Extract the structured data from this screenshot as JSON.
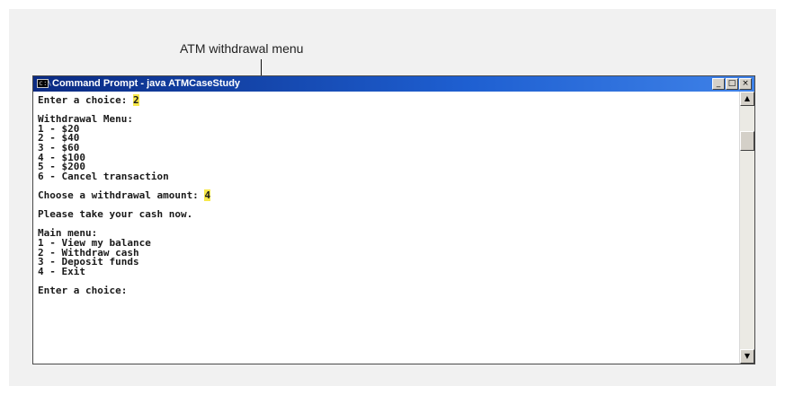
{
  "callout": {
    "label": "ATM withdrawal menu"
  },
  "window": {
    "title": "Command Prompt - java ATMCaseStudy",
    "controls": {
      "minimize": "_",
      "maximize": "□",
      "close": "×"
    }
  },
  "console": {
    "enter_choice_1": {
      "prompt": "Enter a choice: ",
      "input": "2"
    },
    "withdrawal_menu_title": "Withdrawal Menu:",
    "withdrawal_options": [
      "1 - $20",
      "2 - $40",
      "3 - $60",
      "4 - $100",
      "5 - $200",
      "6 - Cancel transaction"
    ],
    "choose_amount": {
      "prompt": "Choose a withdrawal amount: ",
      "input": "4"
    },
    "take_cash": "Please take your cash now.",
    "main_menu_title": "Main menu:",
    "main_menu_options": [
      "1 - View my balance",
      "2 - Withdraw cash",
      "3 - Deposit funds",
      "4 - Exit"
    ],
    "enter_choice_2": "Enter a choice:"
  },
  "scrollbar": {
    "up_arrow": "▲",
    "down_arrow": "▼"
  },
  "colors": {
    "highlight": "#f7e84a",
    "titlebar": "#0a2a82"
  }
}
